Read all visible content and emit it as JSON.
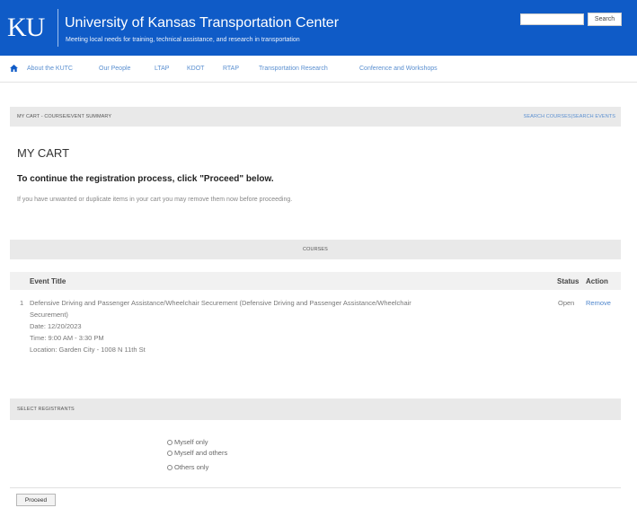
{
  "header": {
    "logo": "KU",
    "title": "University of Kansas Transportation Center",
    "tagline": "Meeting local needs for training, technical assistance, and research in transportation",
    "search_button": "Search",
    "search_value": ""
  },
  "nav": {
    "home_icon": "home-icon",
    "items": [
      "About the KUTC",
      "Our People",
      "LTAP",
      "KDOT",
      "RTAP",
      "Transportation Research",
      "Conference and Workshops"
    ]
  },
  "breadcrumb": {
    "label": "MY CART - COURSE/EVENT SUMMARY",
    "search_courses": "SEARCH COURSES",
    "separator": "|",
    "search_events": "SEARCH EVENTS"
  },
  "cart": {
    "title": "MY CART",
    "subtitle": "To continue the registration process, click \"Proceed\" below.",
    "note": "If you have unwanted or duplicate items in your cart you may remove them now before proceeding."
  },
  "courses": {
    "section_label": "COURSES",
    "headers": {
      "event_title": "Event Title",
      "status": "Status",
      "action": "Action"
    },
    "rows": [
      {
        "number": "1",
        "title_line1": "Defensive Driving and Passenger Assistance/Wheelchair Securement (Defensive Driving and Passenger Assistance/Wheelchair",
        "title_line2": "Securement)",
        "date": "Date: 12/20/2023",
        "time": "Time: 9:00 AM - 3:30 PM",
        "location": "Location: Garden City - 1008 N 11th St",
        "status": "Open",
        "action": "Remove"
      }
    ]
  },
  "registrants": {
    "section_label": "SELECT REGISTRANTS",
    "options": [
      "Myself only",
      "Myself and others",
      "Others only"
    ]
  },
  "proceed_button": "Proceed",
  "colors": {
    "header_blue": "#0f5bc7",
    "link_blue": "#4f86cc",
    "bar_gray": "#e9e9e9"
  }
}
